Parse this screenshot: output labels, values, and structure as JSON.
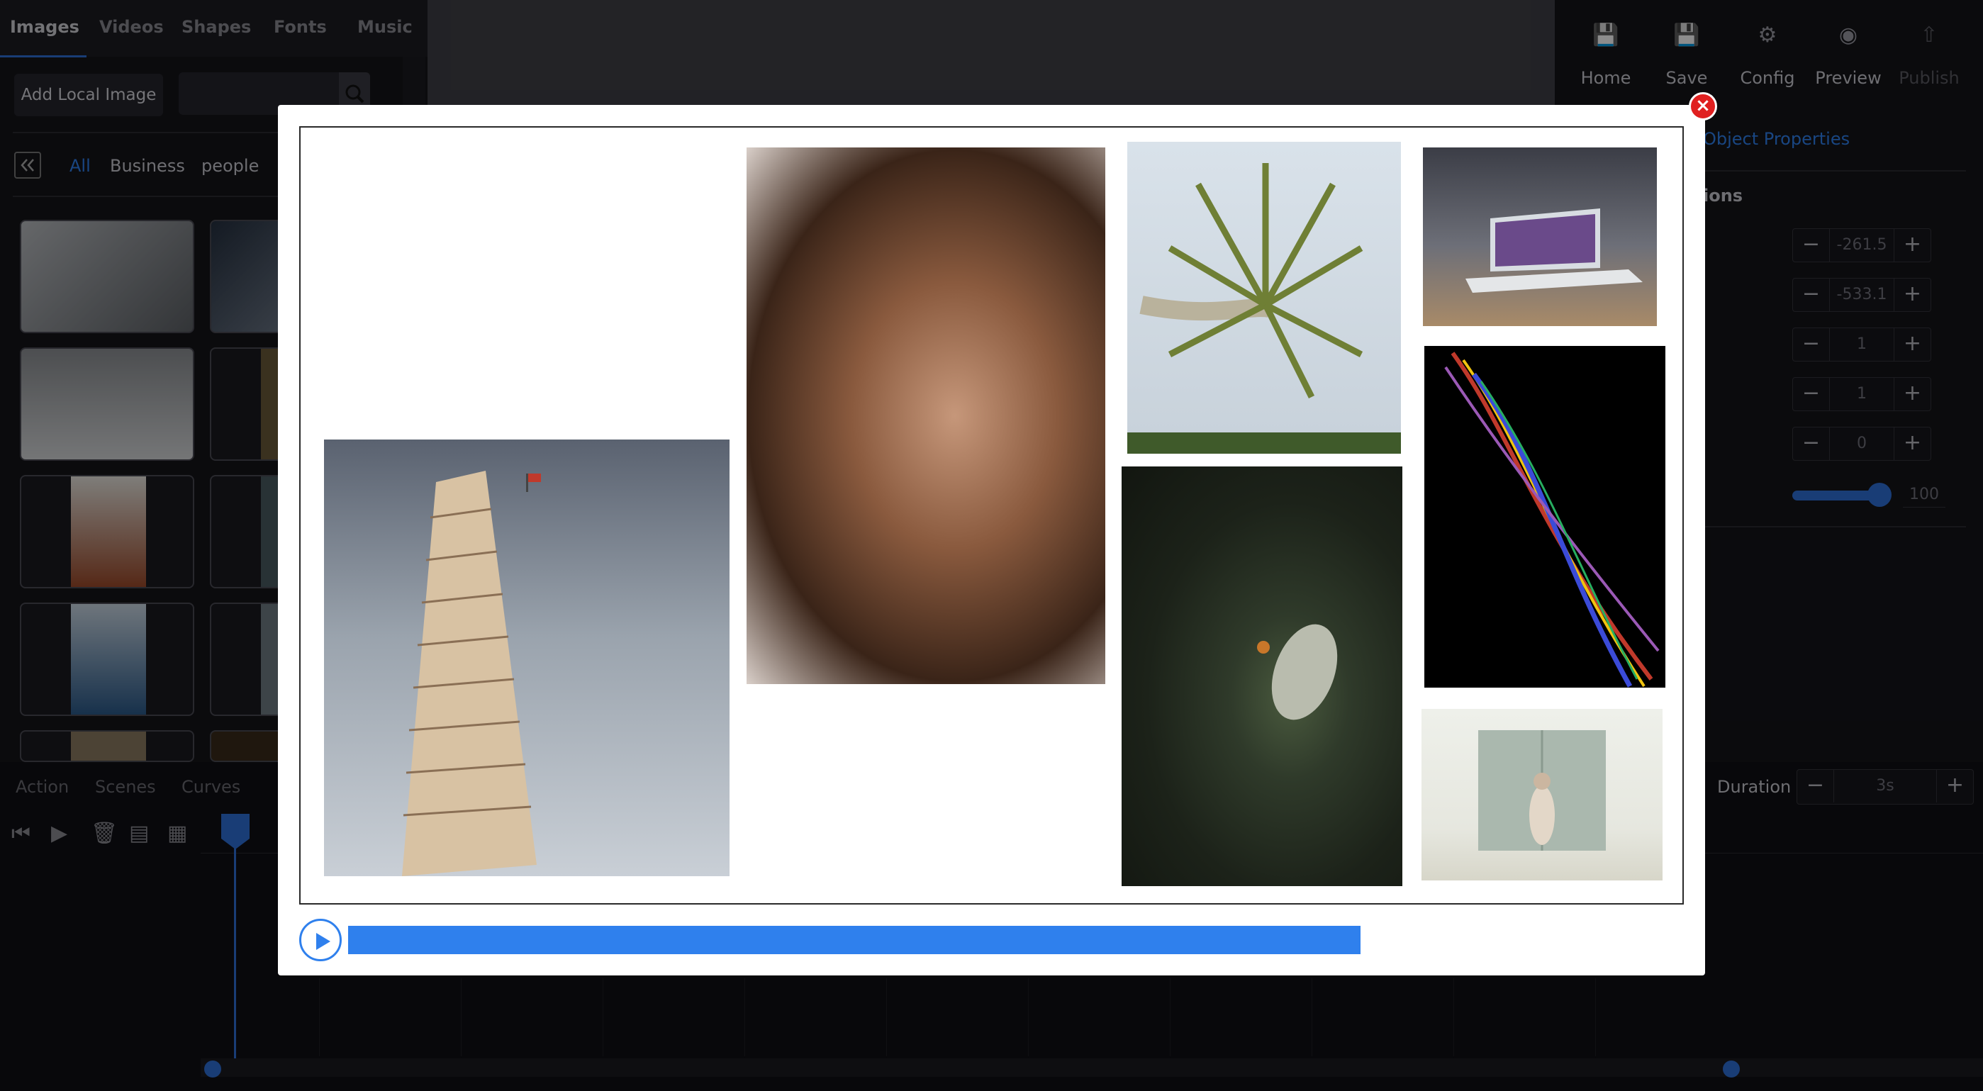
{
  "left_panel": {
    "tabs": [
      {
        "label": "Images",
        "active": true
      },
      {
        "label": "Videos",
        "active": false
      },
      {
        "label": "Shapes",
        "active": false
      },
      {
        "label": "Fonts",
        "active": false
      },
      {
        "label": "Music",
        "active": false
      }
    ],
    "add_local_label": "Add Local Image",
    "search_icon": "search-icon",
    "categories": [
      {
        "label": "All",
        "active": true
      },
      {
        "label": "Business",
        "active": false
      },
      {
        "label": "people",
        "active": false
      }
    ]
  },
  "toolbar": {
    "items": [
      {
        "label": "Home",
        "icon": "floppy-icon",
        "enabled": true
      },
      {
        "label": "Save",
        "icon": "floppy-icon",
        "enabled": true
      },
      {
        "label": "Config",
        "icon": "gear-icon",
        "enabled": true
      },
      {
        "label": "Preview",
        "icon": "preview-icon",
        "enabled": true
      },
      {
        "label": "Publish",
        "icon": "publish-icon",
        "enabled": false
      }
    ]
  },
  "properties": {
    "link": "Object Properties",
    "section": "ions",
    "fields": [
      "-261.5",
      "-533.1",
      "1",
      "1",
      "0"
    ],
    "slider_value": "100"
  },
  "timeline": {
    "tabs": [
      "Action",
      "Scenes",
      "Curves"
    ],
    "duration_label": "Duration",
    "duration_value": "3s"
  },
  "modal": {
    "close_glyph": "×",
    "progress_fraction": 0.64,
    "photos": [
      {
        "name": "leaning-tower-photo",
        "colors": [
          "#5a6270",
          "#c9cfd6"
        ]
      },
      {
        "name": "woman-portrait-photo",
        "colors": [
          "#3a2418",
          "#c6977a"
        ]
      },
      {
        "name": "palm-tree-photo",
        "colors": [
          "#d9e2ea",
          "#7b8a3e"
        ]
      },
      {
        "name": "laptop-office-photo",
        "colors": [
          "#3b3d46",
          "#a88a68"
        ]
      },
      {
        "name": "light-trails-photo",
        "colors": [
          "#000000",
          "#1a0f2a"
        ]
      },
      {
        "name": "ladybug-flower-photo",
        "colors": [
          "#1c2219",
          "#2f3a2a"
        ]
      },
      {
        "name": "barn-woman-photo",
        "colors": [
          "#eef0ea",
          "#d7d6c9"
        ]
      }
    ]
  },
  "colors": {
    "accent": "#2f80ed",
    "close": "#e02020"
  }
}
